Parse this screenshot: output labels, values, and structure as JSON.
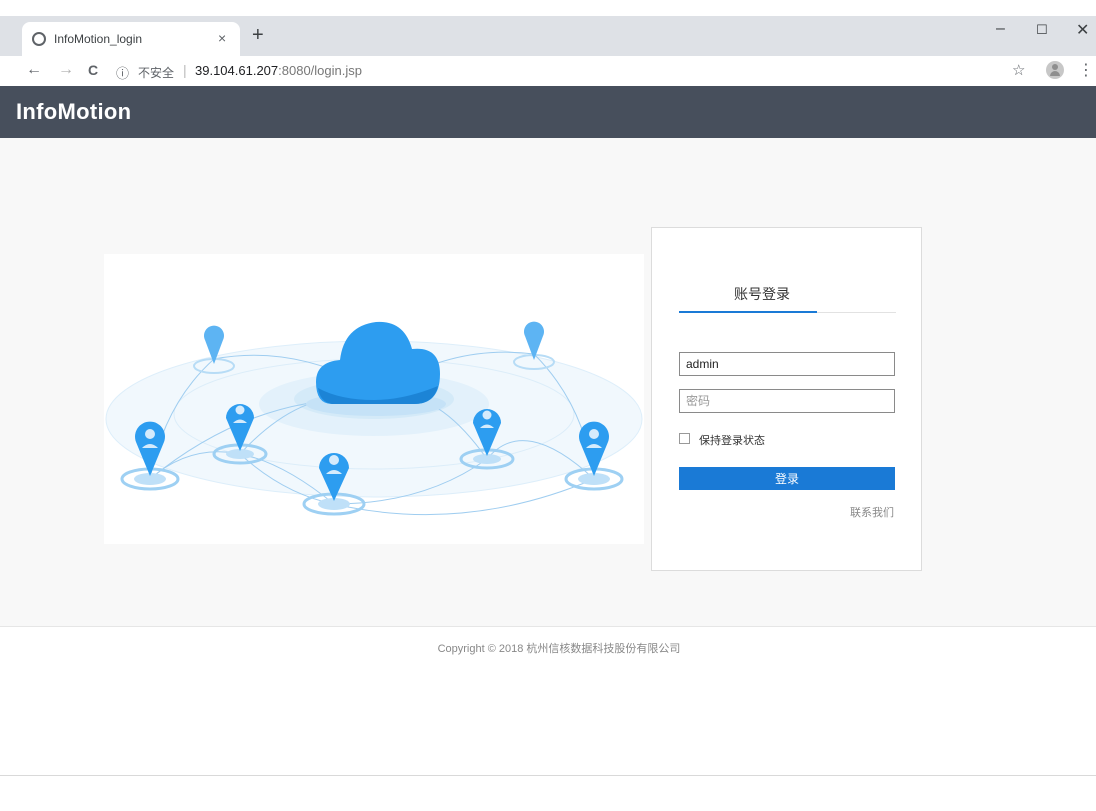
{
  "browser": {
    "tab_title": "InfoMotion_login",
    "tab_close": "×",
    "new_tab": "+",
    "window_controls": {
      "minimize": "–",
      "maximize": "☐",
      "close": "✕"
    },
    "nav": {
      "back": "←",
      "forward": "→",
      "reload": "C"
    },
    "address": {
      "info_icon": "ⓘ",
      "security_label": "不安全",
      "separator": "|",
      "host": "39.104.61.207",
      "path": ":8080/login.jsp"
    },
    "bookmark_icon": "☆",
    "menu_icon": "⋮"
  },
  "app": {
    "brand": "InfoMotion",
    "header_color": "#474f5c"
  },
  "login": {
    "tab_label": "账号登录",
    "username_value": "admin",
    "password_placeholder": "密码",
    "remember_label": "保持登录状态",
    "remember_checked": false,
    "submit_label": "登录",
    "contact_label": "联系我们",
    "accent_color": "#1a7ad6"
  },
  "footer": {
    "copyright": "Copyright © 2018 杭州信核数据科技股份有限公司"
  }
}
